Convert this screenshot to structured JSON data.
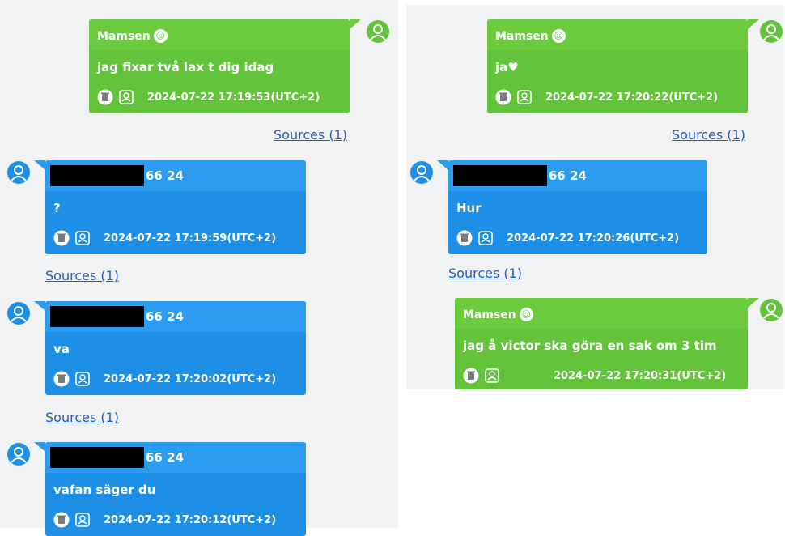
{
  "colors": {
    "outgoing": "#63c33a",
    "incoming": "#1e8fe6",
    "link": "#2a5bb8",
    "panel": "#f1f2f4"
  },
  "left_messages": [
    {
      "direction": "outgoing",
      "sender": "Mamsen",
      "text": "jag fixar två lax t dig idag",
      "timestamp": "2024-07-22 17:19:53(UTC+2)",
      "sources": "Sources (1)"
    },
    {
      "direction": "incoming",
      "sender_suffix": "66 24",
      "text": "?",
      "timestamp": "2024-07-22 17:19:59(UTC+2)",
      "sources": "Sources (1)"
    },
    {
      "direction": "incoming",
      "sender_suffix": "66 24",
      "text": "va",
      "timestamp": "2024-07-22 17:20:02(UTC+2)",
      "sources": "Sources (1)"
    },
    {
      "direction": "incoming",
      "sender_suffix": "66 24",
      "text": "vafan säger du",
      "timestamp": "2024-07-22 17:20:12(UTC+2)"
    }
  ],
  "right_messages": [
    {
      "direction": "outgoing",
      "sender": "Mamsen",
      "text": "ja",
      "timestamp": "2024-07-22 17:20:22(UTC+2)",
      "sources": "Sources (1)"
    },
    {
      "direction": "incoming",
      "sender_suffix": "66 24",
      "text": "Hur",
      "timestamp": "2024-07-22 17:20:26(UTC+2)",
      "sources": "Sources (1)"
    },
    {
      "direction": "outgoing",
      "sender": "Mamsen",
      "text": "jag å victor ska göra en sak om 3 tim",
      "timestamp": "2024-07-22 17:20:31(UTC+2)"
    }
  ],
  "icons": [
    "user-avatar-icon",
    "emoji-icon",
    "trash-icon",
    "contact-icon",
    "heart-icon"
  ]
}
